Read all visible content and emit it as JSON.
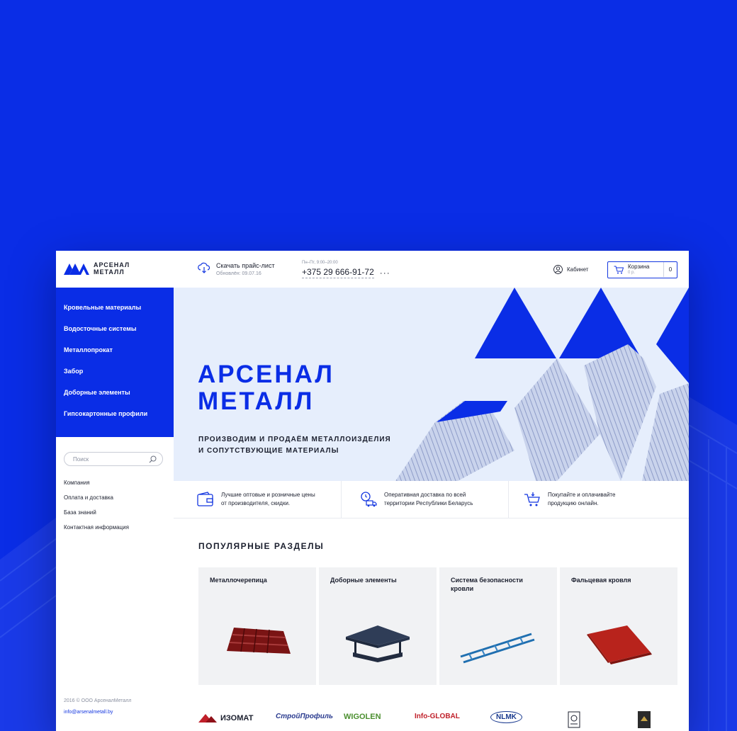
{
  "header": {
    "logo_line1": "АРСЕНАЛ",
    "logo_line2": "МЕТАЛЛ",
    "price_title": "Скачать прайс-лист",
    "price_updated": "Обновлён: 09.07.16",
    "phone_hours": "Пн–Пт, 9:00–20:00",
    "phone": "+375 29 666-91-72",
    "more": "···",
    "cabinet": "Кабинет",
    "cart_title": "Корзина",
    "cart_sum": "0 р.",
    "cart_count": "0"
  },
  "sidebar": {
    "categories": [
      "Кровельные материалы",
      "Водосточные системы",
      "Металлопрокат",
      "Забор",
      "Доборные элементы",
      "Гипсокартонные профили"
    ],
    "search_placeholder": "Поиск",
    "links": [
      "Компания",
      "Оплата и доставка",
      "База знаний",
      "Контактная информация"
    ],
    "copyright": "2016 © ООО АрсеналМеталл",
    "email": "info@arsenalmetall.by"
  },
  "hero": {
    "title_line1": "АРСЕНАЛ",
    "title_line2": "МЕТАЛЛ",
    "subtitle_line1": "ПРОИЗВОДИМ И ПРОДАЁМ МЕТАЛЛОИЗДЕЛИЯ",
    "subtitle_line2": "И СОПУТСТВУЮЩИЕ МАТЕРИАЛЫ"
  },
  "features": [
    {
      "line1": "Лучшие оптовые и розничные цены",
      "line2": "от производителя, скидки.",
      "icon": "wallet-icon"
    },
    {
      "line1": "Оперативная доставка по всей",
      "line2": "территории Республики Беларусь",
      "icon": "delivery-icon"
    },
    {
      "line1": "Покупайте и оплачивайте",
      "line2": "продукцию онлайн.",
      "icon": "cart-icon"
    }
  ],
  "popular": {
    "title": "ПОПУЛЯРНЫЕ РАЗДЕЛЫ",
    "tiles": [
      {
        "label": "Металлочерепица"
      },
      {
        "label": "Доборные элементы"
      },
      {
        "label": "Система безопасности кровли"
      },
      {
        "label": "Фальцевая кровля"
      }
    ]
  },
  "brands": [
    "ИЗОМАТ",
    "СтройПрофиль",
    "WIGOLEN",
    "Info-GLOBAL",
    "NLMK"
  ],
  "colors": {
    "accent": "#0a2de6",
    "text": "#1b1f2e",
    "muted": "#8a90a0"
  }
}
